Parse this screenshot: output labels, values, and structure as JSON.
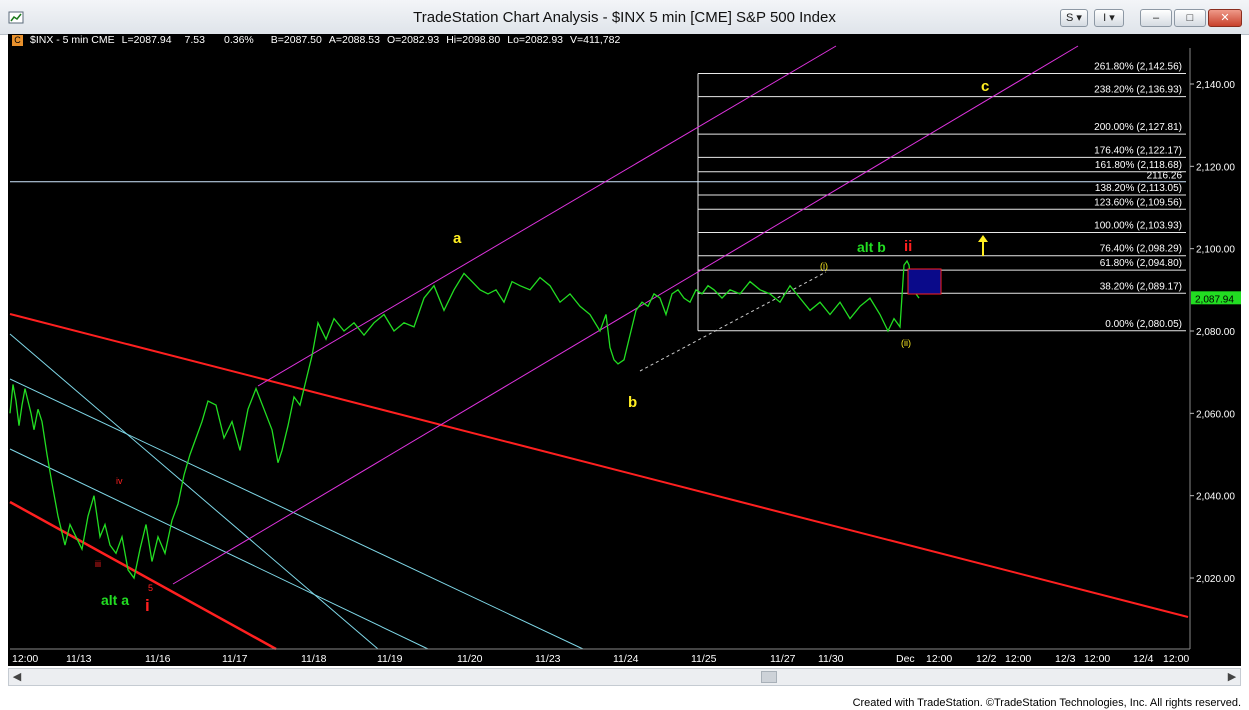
{
  "window": {
    "title": "TradeStation Chart Analysis - $INX 5 min [CME] S&P 500 Index",
    "buttons": [
      "S",
      "I",
      "–",
      "□",
      "✕"
    ]
  },
  "info_bar": {
    "badge": "C",
    "symbol": "$INX - 5 min  CME",
    "last": "L=2087.94",
    "change": "7.53",
    "pct": "0.36%",
    "bid": "B=2087.50",
    "ask": "A=2088.53",
    "open": "O=2082.93",
    "high": "Hi=2098.80",
    "low": "Lo=2082.93",
    "volume": "V=411,782"
  },
  "footer": "Created with TradeStation. ©TradeStation Technologies, Inc. All rights reserved.",
  "colors": {
    "background": "#000000",
    "price": "#22dd22",
    "grid": "#1a1a1a",
    "fib": "#ffffff",
    "red_line": "#ff2020",
    "magenta": "#dd33dd",
    "cyan": "#7fd8e8",
    "yellow": "#ffee22"
  },
  "chart_data": {
    "type": "line",
    "title": "$INX 5 min [CME] S&P 500 Index",
    "ylim": [
      2005,
      2148
    ],
    "x_tick_labels": [
      "12:00",
      "11/13",
      "11/16",
      "11/17",
      "11/18",
      "11/19",
      "11/20",
      "11/23",
      "11/24",
      "11/25",
      "11/27",
      "11/30",
      "Dec",
      "12:00",
      "12/2",
      "12:00",
      "12/3",
      "12:00",
      "12/4",
      "12:00"
    ],
    "y_ticks": [
      2020,
      2040,
      2060,
      2080,
      2100,
      2120,
      2140
    ],
    "y_tick_labels": [
      "2,020.00",
      "2,040.00",
      "2,060.00",
      "2,080.00",
      "2,100.00",
      "2,120.00",
      "2,140.00"
    ],
    "last_price_label": "2,087.94",
    "series": [
      {
        "x": [
          0,
          3,
          6,
          9,
          12,
          15,
          18,
          21,
          24,
          28,
          32,
          37,
          42,
          48,
          55,
          60,
          66,
          72,
          78,
          84,
          90,
          95,
          100,
          106,
          112,
          118,
          124,
          130,
          136,
          142,
          148,
          155,
          162,
          168,
          174,
          180,
          186,
          192,
          198,
          206,
          214,
          222,
          230,
          238,
          246,
          254,
          262,
          268,
          272,
          278,
          284,
          290,
          296,
          302,
          308,
          316,
          324,
          334,
          344,
          354,
          364,
          374,
          384,
          394,
          404,
          414,
          424,
          434,
          444,
          454,
          462,
          470,
          478,
          486,
          494,
          502,
          510,
          520,
          530,
          540,
          550,
          560,
          570,
          580,
          590,
          596,
          600,
          604,
          608,
          614,
          620,
          626,
          632,
          638,
          644,
          650,
          656,
          662,
          668,
          674,
          680,
          686,
          692,
          698,
          704,
          712,
          720,
          730,
          740,
          750,
          760,
          770,
          780,
          790,
          800,
          810,
          820,
          830,
          840,
          850,
          860,
          870,
          878,
          884,
          890,
          894,
          897,
          899,
          901,
          903,
          906,
          909
        ],
        "values": [
          2060,
          2067,
          2063,
          2057,
          2062,
          2066,
          2063,
          2060,
          2056,
          2061,
          2058,
          2050,
          2043,
          2035,
          2028,
          2033,
          2030,
          2027,
          2035,
          2040,
          2030,
          2033,
          2028,
          2026,
          2030,
          2022,
          2020,
          2027,
          2033,
          2024,
          2030,
          2026,
          2034,
          2038,
          2045,
          2050,
          2054,
          2058,
          2063,
          2062,
          2054,
          2058,
          2051,
          2061,
          2066,
          2061,
          2056,
          2048,
          2051,
          2057,
          2064,
          2062,
          2068,
          2074,
          2082,
          2078,
          2083,
          2080,
          2082,
          2079,
          2082,
          2084,
          2080,
          2082,
          2081,
          2088,
          2091,
          2085,
          2090,
          2094,
          2092,
          2090,
          2089,
          2090,
          2087,
          2092,
          2091,
          2090,
          2093,
          2091,
          2087,
          2089,
          2086,
          2084,
          2080,
          2084,
          2076,
          2073,
          2072,
          2073,
          2079,
          2085,
          2087,
          2086,
          2089,
          2088,
          2084,
          2089,
          2090,
          2088,
          2087,
          2090,
          2089,
          2091,
          2090,
          2088,
          2090,
          2089,
          2092,
          2090,
          2089,
          2087,
          2091,
          2088,
          2085,
          2087,
          2084,
          2087,
          2083,
          2086,
          2088,
          2084,
          2080,
          2083,
          2081,
          2096,
          2097,
          2096,
          2092,
          2094,
          2089,
          2088
        ]
      }
    ],
    "fib_levels": [
      {
        "label": "261.80% (2,142.56)",
        "value": 2142.56
      },
      {
        "label": "238.20% (2,136.93)",
        "value": 2136.93
      },
      {
        "label": "200.00% (2,127.81)",
        "value": 2127.81
      },
      {
        "label": "176.40% (2,122.17)",
        "value": 2122.17
      },
      {
        "label": "161.80% (2,118.68)",
        "value": 2118.68
      },
      {
        "label": "138.20% (2,113.05)",
        "value": 2113.05
      },
      {
        "label": "123.60% (2,109.56)",
        "value": 2109.56
      },
      {
        "label": "100.00% (2,103.93)",
        "value": 2103.93
      },
      {
        "label": "76.40% (2,098.29)",
        "value": 2098.29
      },
      {
        "label": "61.80% (2,094.80)",
        "value": 2094.8
      },
      {
        "label": "38.20% (2,089.17)",
        "value": 2089.17
      },
      {
        "label": "0.00% (2,080.05)",
        "value": 2080.05
      }
    ],
    "horizontal_line": {
      "label": "2116.26",
      "value": 2116.26
    },
    "wave_labels": [
      {
        "text": "a",
        "color": "#ffee22"
      },
      {
        "text": "b",
        "color": "#ffee22"
      },
      {
        "text": "c",
        "color": "#ffee22"
      },
      {
        "text": "alt a",
        "color": "#22dd22"
      },
      {
        "text": "alt b",
        "color": "#22dd22"
      },
      {
        "text": "i",
        "color": "#ff2020"
      },
      {
        "text": "ii",
        "color": "#ff2020"
      },
      {
        "text": "iii",
        "color": "#ff2020"
      },
      {
        "text": "iv",
        "color": "#ff2020"
      },
      {
        "text": "5",
        "color": "#ff2020"
      },
      {
        "text": "(i)",
        "color": "#ffee22"
      },
      {
        "text": "(ii)",
        "color": "#ffee22"
      }
    ]
  }
}
